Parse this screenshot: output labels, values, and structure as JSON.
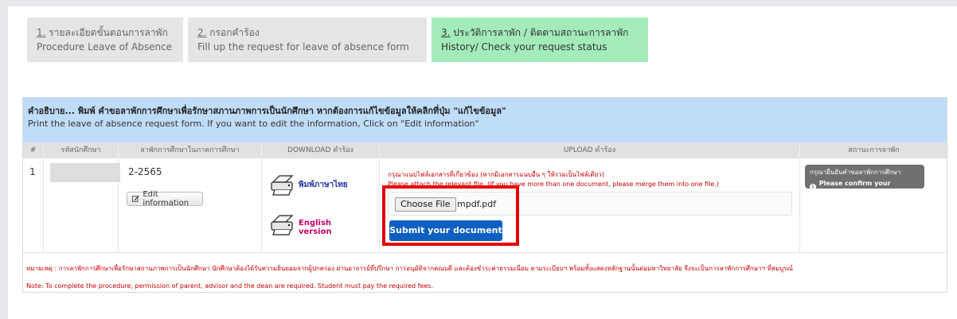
{
  "tabs": [
    {
      "num": "1.",
      "title": "รายละเอียดขั้นตอนการลาพัก",
      "subtitle": "Procedure Leave of Absence"
    },
    {
      "num": "2.",
      "title": "กรอกคำร้อง",
      "subtitle": "Fill up the request for leave of absence form"
    },
    {
      "num": "3.",
      "title": "ประวัติการลาพัก / ติดตามสถานะการลาพัก",
      "subtitle": "History/ Check your request status"
    }
  ],
  "description": {
    "thai": "คำอธิบาย... พิมพ์ คำขอลาพักการศึกษาเพื่อรักษาสภานภาพการเป็นนักศึกษา หากต้องการแก้ไขข้อมูลให้คลิกที่ปุ่ม \"แก้ไขข้อมูล\"",
    "english": "Print the leave of absence request form. If you want to edit the information, Click on \"Edit information\""
  },
  "table": {
    "headers": [
      "#",
      "รหัสนักศึกษา",
      "ลาพักการศึกษาในภาคการศึกษา",
      "DOWNLOAD คำร้อง",
      "UPLOAD คำร้อง",
      "สถานะการลาพัก"
    ],
    "row": {
      "num": "1",
      "term": "2-2565",
      "edit_label": "Edit information",
      "download_thai": "พิมพ์ภาษาไทย",
      "download_english": "English version",
      "upload_instruction_thai": "กรุณาแนบไฟล์เอกสารที่เกี่ยวข้อง (หากมีเอกสารแนบอื่น ๆ ให้รวมเป็นไฟล์เดียว)",
      "upload_instruction_english": "Please attach the relevant file. (If you have more than one document, please merge them into one file.)",
      "choose_file_label": "Choose File",
      "file_name": "mpdf.pdf",
      "submit_label": "Submit your document",
      "status_line1": "กรุณายืนยันคำขอลาพักการศึกษา",
      "status_line2": "Please confirm your request."
    }
  },
  "notes": {
    "thai": "หมายเหตุ : การลาพักการศึกษาเพื่อรักษาสถานภาพการเป็นนักศึกษา นักศึกษาต้องได้รับความยินยอมจากผู้ปกครอง ผ่านอาจารย์ที่ปรึกษา การอนุมัติจากคณบดี และต้องชำระค่าธรรมเนียม ตามระเบียบฯ พร้อมทั้งแสดงหลักฐานนั้นต่อมหาวิทยาลัย จึงจะเป็นการลาพักการศึกษาฯ ที่สมบูรณ์",
    "english": "Note: To complete the procedure, permission of parent, advisor and the dean are required. Student must pay the required fees."
  },
  "colors": {
    "active_tab": "#a3ecb9",
    "description_bg": "#bfdcf8",
    "submit_button": "#0d5fc0",
    "highlight_border": "#e50000",
    "note_text": "#cc0000"
  }
}
